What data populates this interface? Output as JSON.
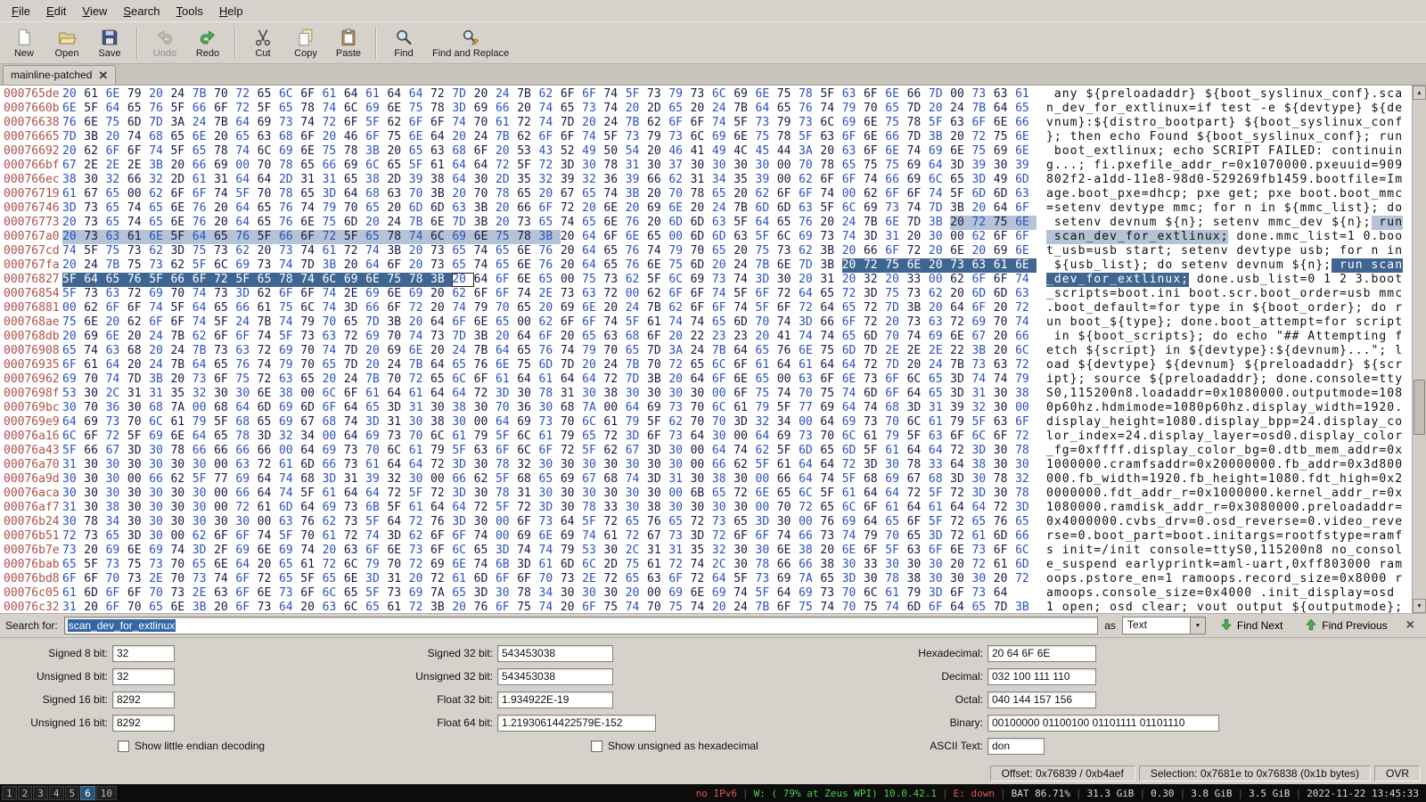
{
  "colors": {
    "chrome_bg": "#d6d2cb",
    "hex_even": "#2c50c0",
    "hex_odd": "#191945",
    "offset_red": "#b0504a",
    "selection_bg": "#3f6591",
    "match_bg": "#b4c3d6",
    "accent_blue": "#3465a4",
    "status_green": "#4ad24a",
    "status_red": "#e25555"
  },
  "menu": {
    "items": [
      "File",
      "Edit",
      "View",
      "Search",
      "Tools",
      "Help"
    ]
  },
  "toolbar": {
    "buttons": [
      {
        "label": "New",
        "icon": "new-document-icon",
        "enabled": true
      },
      {
        "label": "Open",
        "icon": "open-folder-icon",
        "enabled": true
      },
      {
        "label": "Save",
        "icon": "save-icon",
        "enabled": true
      },
      {
        "separator": true
      },
      {
        "label": "Undo",
        "icon": "undo-icon",
        "enabled": false
      },
      {
        "label": "Redo",
        "icon": "redo-icon",
        "enabled": true
      },
      {
        "separator": true
      },
      {
        "label": "Cut",
        "icon": "cut-icon",
        "enabled": true
      },
      {
        "label": "Copy",
        "icon": "copy-icon",
        "enabled": true
      },
      {
        "label": "Paste",
        "icon": "paste-icon",
        "enabled": true
      },
      {
        "separator": true
      },
      {
        "label": "Find",
        "icon": "find-icon",
        "enabled": true
      },
      {
        "label": "Find and Replace",
        "icon": "find-replace-icon",
        "enabled": true
      }
    ]
  },
  "tab": {
    "title": "mainline-patched"
  },
  "hex_view": {
    "bytes_per_row": 45,
    "selection": {
      "current_start": "0x7681e",
      "current_end": "0x76838",
      "match_start": "0x7679c",
      "match_end": "0x767b6",
      "cursor": "0x76839"
    },
    "rows": [
      {
        "offset": "000765de",
        "text": " any ${preloadaddr} ${boot_syslinux_conf}\u0000sca"
      },
      {
        "offset": "0007660b",
        "text": "n_dev_for_extlinux=if test -e ${devtype} ${de"
      },
      {
        "offset": "00076638",
        "text": "vnum}:${distro_bootpart} ${boot_syslinux_conf"
      },
      {
        "offset": "00076665",
        "text": "}; then echo Found ${boot_syslinux_conf}; run"
      },
      {
        "offset": "00076692",
        "text": " boot_extlinux; echo SCRIPT FAILED: continuin"
      },
      {
        "offset": "000766bf",
        "text": "g...; fi\u0000pxefile_addr_r=0x1070000\u0000pxeuuid=909"
      },
      {
        "offset": "000766ec",
        "text": "802f2-a1dd-11e8-98d0-529269fb1459\u0000bootfile=Im"
      },
      {
        "offset": "00076719",
        "text": "age\u0000boot_pxe=dhcp; pxe get; pxe boot\u0000boot_mmc"
      },
      {
        "offset": "00076746",
        "text": "=setenv devtype mmc; for n in ${mmc_list}; do"
      },
      {
        "offset": "00076773",
        "text": " setenv devnum ${n}; setenv mmc_dev ${n}; run"
      },
      {
        "offset": "000767a0",
        "text": " scan_dev_for_extlinux; done\u0000mmc_list=1 0\u0000boo"
      },
      {
        "offset": "000767cd",
        "text": "t_usb=usb start; setenv devtype usb; for n in"
      },
      {
        "offset": "000767fa",
        "text": " ${usb_list}; do setenv devnum ${n}; run scan"
      },
      {
        "offset": "00076827",
        "text": "_dev_for_extlinux; done\u0000usb_list=0 1 2 3\u0000boot"
      },
      {
        "offset": "00076854",
        "text": "_scripts=boot.ini boot.scr\u0000boot_order=usb mmc"
      },
      {
        "offset": "00076881",
        "text": "\u0000boot_default=for type in ${boot_order}; do r"
      },
      {
        "offset": "000768ae",
        "text": "un boot_${type}; done\u0000boot_attempt=for script"
      },
      {
        "offset": "000768db",
        "text": " in ${boot_scripts}; do echo \"## Attempting f"
      },
      {
        "offset": "00076908",
        "text": "etch ${script} in ${devtype}:${devnum}...\"; l"
      },
      {
        "offset": "00076935",
        "text": "oad ${devtype} ${devnum} ${preloadaddr} ${scr"
      },
      {
        "offset": "00076962",
        "text": "ipt}; source ${preloadaddr}; done\u0000console=tty"
      },
      {
        "offset": "0007698f",
        "text": "S0,115200n8\u0000loadaddr=0x1080000\u0000outputmode=108"
      },
      {
        "offset": "000769bc",
        "text": "0p60hz\u0000hdmimode=1080p60hz\u0000display_width=1920\u0000"
      },
      {
        "offset": "000769e9",
        "text": "display_height=1080\u0000display_bpp=24\u0000display_co"
      },
      {
        "offset": "00076a16",
        "text": "lor_index=24\u0000display_layer=osd0\u0000display_color"
      },
      {
        "offset": "00076a43",
        "text": "_fg=0xffff\u0000display_color_bg=0\u0000dtb_mem_addr=0x"
      },
      {
        "offset": "00076a70",
        "text": "1000000\u0000cramfsaddr=0x20000000\u0000fb_addr=0x3d800"
      },
      {
        "offset": "00076a9d",
        "text": "000\u0000fb_width=1920\u0000fb_height=1080\u0000fdt_high=0x2"
      },
      {
        "offset": "00076aca",
        "text": "0000000\u0000fdt_addr_r=0x1000000\u0000kernel_addr_r=0x"
      },
      {
        "offset": "00076af7",
        "text": "1080000\u0000ramdisk_addr_r=0x3080000\u0000preloadaddr="
      },
      {
        "offset": "00076b24",
        "text": "0x4000000\u0000cvbs_drv=0\u0000osd_reverse=0\u0000video_reve"
      },
      {
        "offset": "00076b51",
        "text": "rse=0\u0000boot_part=boot\u0000initargs=rootfstype=ramf"
      },
      {
        "offset": "00076b7e",
        "text": "s init=/init console=ttyS0,115200n8 no_consol"
      },
      {
        "offset": "00076bab",
        "text": "e_suspend earlyprintk=aml-uart,0xff803000 ram"
      },
      {
        "offset": "00076bd8",
        "text": "oops.pstore_en=1 ramoops.record_size=0x8000 r"
      },
      {
        "offset": "00076c05",
        "text": "amoops.console_size=0x4000 \u0000init_display=osd"
      },
      {
        "offset": "00076c32",
        "text": "1 open; osd clear; vout output ${outputmode};"
      }
    ]
  },
  "search_bar": {
    "label": "Search for:",
    "value": "scan_dev_for_extlinux",
    "as_label": "as",
    "type_value": "Text",
    "find_next_label": "Find Next",
    "find_previous_label": "Find Previous"
  },
  "inspector": {
    "left": {
      "rows": [
        {
          "label": "Signed 8 bit:",
          "value": "32"
        },
        {
          "label": "Unsigned 8 bit:",
          "value": "32"
        },
        {
          "label": "Signed 16 bit:",
          "value": "8292"
        },
        {
          "label": "Unsigned 16 bit:",
          "value": "8292"
        }
      ],
      "checkbox": "Show little endian decoding"
    },
    "middle": {
      "rows": [
        {
          "label": "Signed 32 bit:",
          "value": "543453038"
        },
        {
          "label": "Unsigned 32 bit:",
          "value": "543453038"
        },
        {
          "label": "Float 32 bit:",
          "value": "1.934922E-19"
        },
        {
          "label": "Float 64 bit:",
          "value": "1.21930614422579E-152"
        }
      ],
      "checkbox": "Show unsigned as hexadecimal"
    },
    "right": {
      "rows": [
        {
          "label": "Hexadecimal:",
          "value": "20 64 6F 6E"
        },
        {
          "label": "Decimal:",
          "value": "032 100 111 110"
        },
        {
          "label": "Octal:",
          "value": "040 144 157 156"
        },
        {
          "label": "Binary:",
          "value": "00100000 01100100 01101111 01101110"
        },
        {
          "label": "ASCII Text:",
          "value": "don"
        }
      ]
    }
  },
  "status_bar": {
    "offset": "Offset: 0x76839 / 0xb4aef",
    "selection": "Selection: 0x7681e to 0x76838 (0x1b bytes)",
    "mode": "OVR"
  },
  "taskbar": {
    "workspaces": [
      "1",
      "2",
      "3",
      "4",
      "5",
      "6",
      "10"
    ],
    "active_workspace": "6",
    "status_segments": [
      {
        "text": "no IPv6",
        "color": "#e25555"
      },
      {
        "text": "W: ( 79% at Zeus WPI) 10.0.42.1",
        "color": "#4ad24a"
      },
      {
        "text": "E: down",
        "color": "#e25555"
      },
      {
        "text": "BAT 86.71%",
        "color": "#dcdcdc"
      },
      {
        "text": "31.3 GiB",
        "color": "#dcdcdc"
      },
      {
        "text": "0.30",
        "color": "#dcdcdc"
      },
      {
        "text": "3.8 GiB",
        "color": "#dcdcdc"
      },
      {
        "text": "3.5 GiB",
        "color": "#dcdcdc"
      },
      {
        "text": "2022-11-22 13:45:33",
        "color": "#dcdcdc"
      }
    ]
  }
}
